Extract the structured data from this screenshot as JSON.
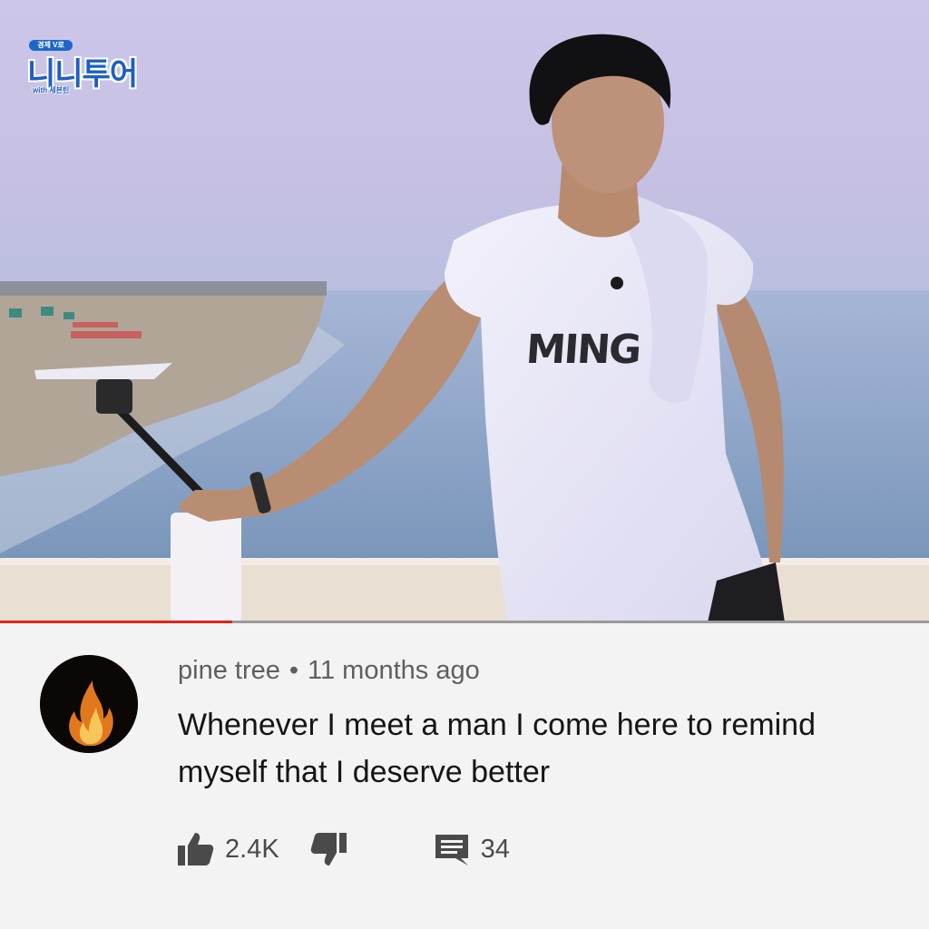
{
  "video": {
    "logo": {
      "badge": "경제 V로",
      "main": "니니투어",
      "sub": "with 세븐틴"
    },
    "shirt_print": "MING",
    "progress_fraction": 0.25,
    "colors": {
      "progress": "#e62117",
      "sky": "#c9c3e6",
      "sea": "#7f9fc1"
    }
  },
  "comment": {
    "author": "pine tree",
    "separator": "•",
    "time": "11 months ago",
    "text": "Whenever I meet a man I come here to remind myself that I deserve better",
    "avatar_icon": "fire-icon",
    "actions": {
      "like_icon": "thumbs-up-icon",
      "like_count": "2.4K",
      "dislike_icon": "thumbs-down-icon",
      "reply_icon": "comment-icon",
      "reply_count": "34"
    }
  }
}
